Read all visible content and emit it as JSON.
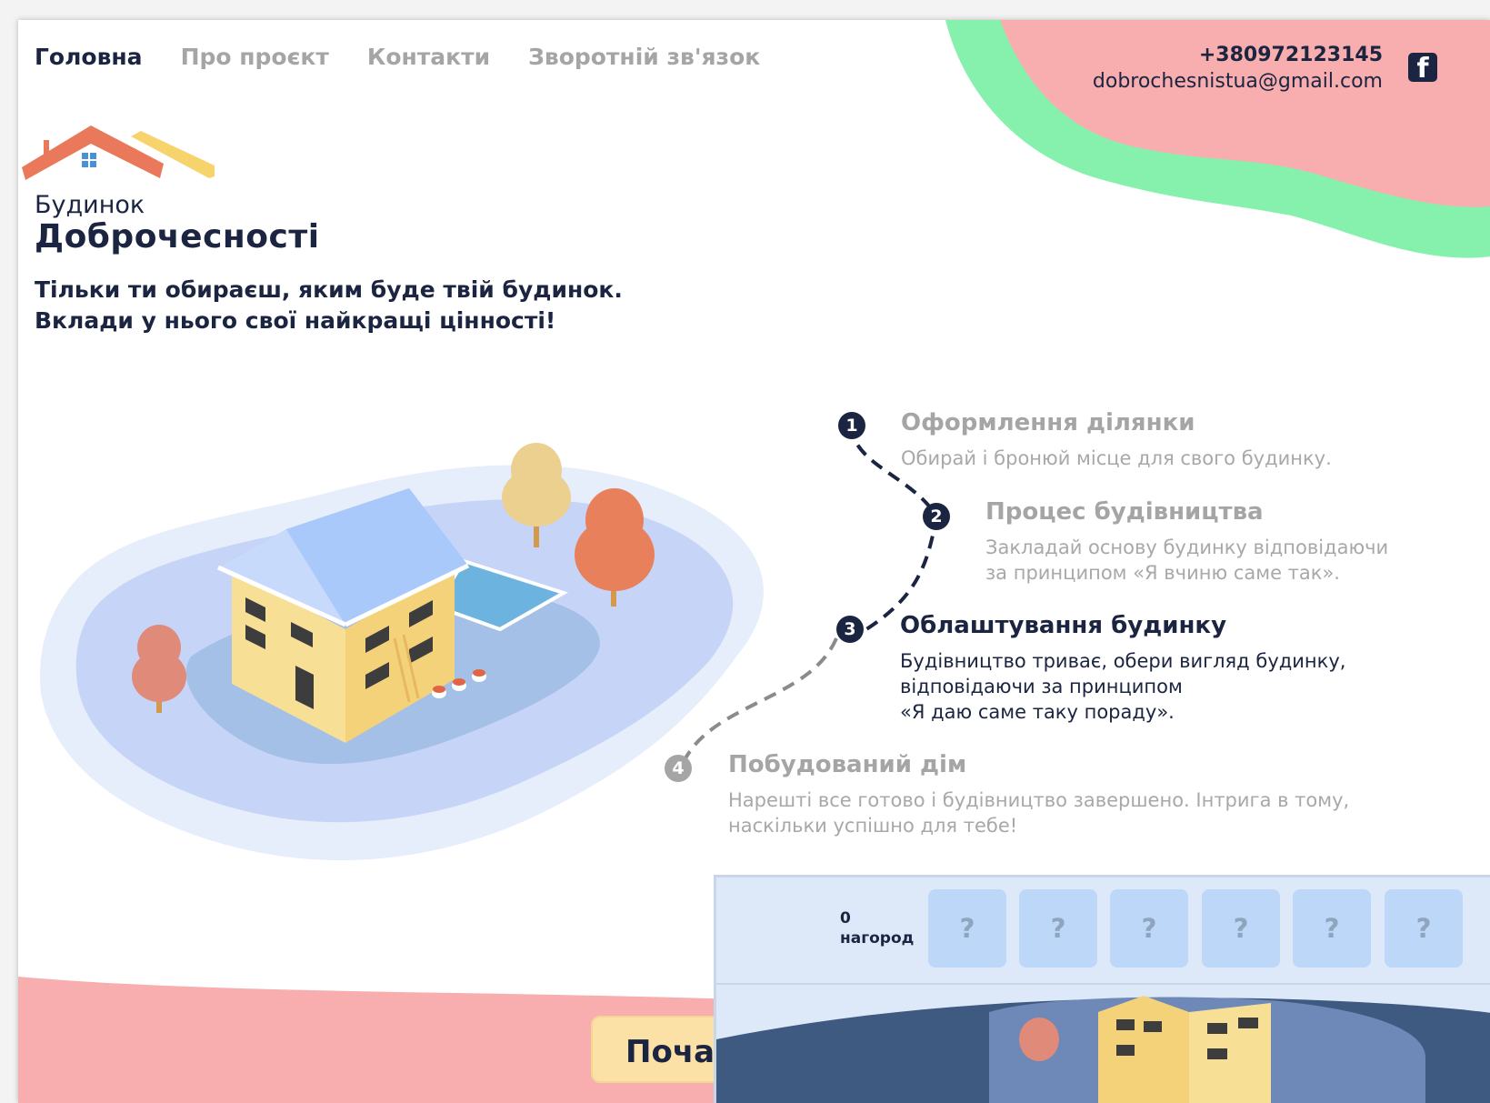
{
  "nav": {
    "items": [
      "Головна",
      "Про проєкт",
      "Контакти",
      "Зворотній зв'язок"
    ]
  },
  "contacts": {
    "phone": "+380972123145",
    "email": "dobrochesnistua@gmail.com",
    "fb_glyph": "f"
  },
  "logo": {
    "line1": "Будинок",
    "line2": "Доброчесності"
  },
  "tagline": {
    "line1": "Тільки ти обираєш, яким буде твій будинок.",
    "line2": "Вклади у нього свої найкращі цінності!"
  },
  "steps": [
    {
      "num": "1",
      "title": "Оформлення ділянки",
      "lines": [
        "Обирай і бронюй місце для свого будинку."
      ],
      "state": "done"
    },
    {
      "num": "2",
      "title": "Процес будівництва",
      "lines": [
        "Закладай основу будинку відповідаючи",
        "за принципом «Я вчиню саме так»."
      ],
      "state": "done"
    },
    {
      "num": "3",
      "title": "Облаштування будинку",
      "lines": [
        "Будівництво триває, обери вигляд будинку,",
        "відповідаючи за принципом",
        "«Я даю саме таку пораду»."
      ],
      "state": "active"
    },
    {
      "num": "4",
      "title": "Побудований дім",
      "lines": [
        "Нарешті все готово і будівництво завершено. Інтрига в тому,",
        "наскільки успішно для тебе!"
      ],
      "state": "pending"
    }
  ],
  "start_button": {
    "label": "Почати"
  },
  "awards": {
    "count": "0",
    "label": "нагород",
    "slots": [
      "?",
      "?",
      "?",
      "?",
      "?",
      "?"
    ]
  },
  "colors": {
    "navy": "#1b2440",
    "blob_pink": "#f8aeae",
    "blob_green": "#86f1ad",
    "award_slot": "#bcd7f7",
    "start_button": "#fbe1a6"
  },
  "icons": [
    "facebook-icon",
    "logo-roof-icon",
    "house-illustration"
  ]
}
